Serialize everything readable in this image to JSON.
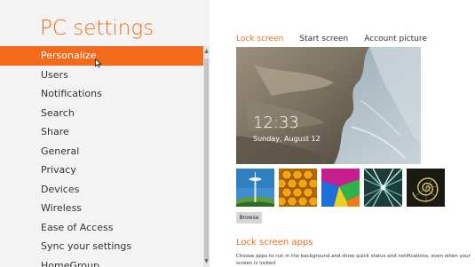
{
  "app": {
    "title": "PC settings"
  },
  "sidebar": {
    "items": [
      {
        "label": "Personalize",
        "active": true
      },
      {
        "label": "Users"
      },
      {
        "label": "Notifications"
      },
      {
        "label": "Search"
      },
      {
        "label": "Share"
      },
      {
        "label": "General"
      },
      {
        "label": "Privacy"
      },
      {
        "label": "Devices"
      },
      {
        "label": "Wireless"
      },
      {
        "label": "Ease of Access"
      },
      {
        "label": "Sync your settings"
      },
      {
        "label": "HomeGroup"
      }
    ]
  },
  "tabs": [
    {
      "label": "Lock screen",
      "active": true
    },
    {
      "label": "Start screen"
    },
    {
      "label": "Account picture"
    }
  ],
  "lock_screen": {
    "time": "12:33",
    "date": "Sunday, August 12"
  },
  "thumbnails": [
    {
      "icon": "space-needle-image"
    },
    {
      "icon": "honeycomb-image"
    },
    {
      "icon": "color-blocks-image"
    },
    {
      "icon": "light-trails-image"
    },
    {
      "icon": "nautilus-shell-image"
    }
  ],
  "browse_label": "Browse",
  "lock_screen_apps": {
    "heading": "Lock screen apps",
    "description": "Choose apps to run in the background and show quick status and notifications, even when your screen is locked"
  },
  "colors": {
    "accent": "#f26a1b",
    "sidebar_bg": "#f3f3f3"
  }
}
